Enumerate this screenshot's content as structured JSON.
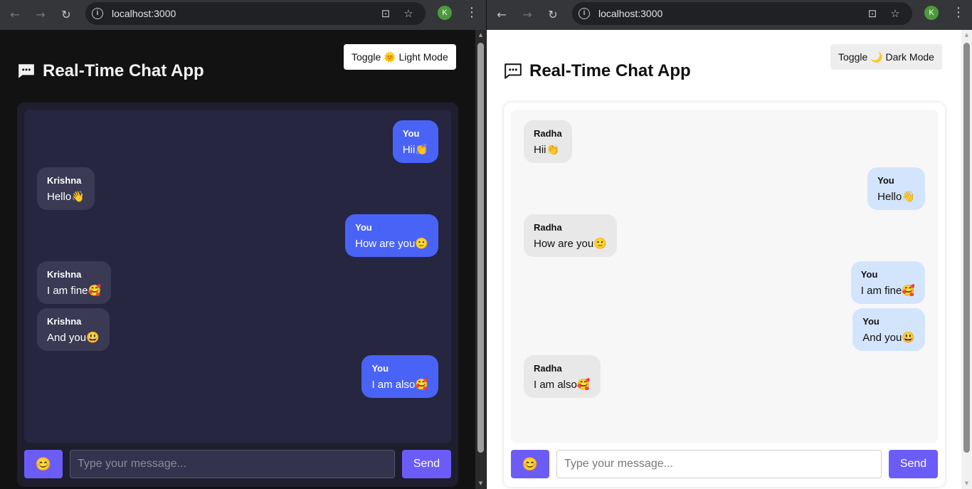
{
  "browser": {
    "url": "localhost:3000",
    "back_icon": "←",
    "forward_icon": "→",
    "reload_icon": "↻",
    "info_icon": "i",
    "install_icon": "⊡",
    "star_icon": "☆",
    "profile_initial": "K",
    "menu_icon": "⋮"
  },
  "app": {
    "title": "Real-Time Chat App",
    "placeholder": "Type your message...",
    "send_label": "Send",
    "emoji_button": "😊"
  },
  "dark_view": {
    "toggle_label": "Toggle 🌞 Light Mode",
    "messages": [
      {
        "from": "me",
        "sender": "You",
        "text": "Hii👏"
      },
      {
        "from": "them",
        "sender": "Krishna",
        "text": "Hello👋"
      },
      {
        "from": "me",
        "sender": "You",
        "text": "How are you🙂"
      },
      {
        "from": "them",
        "sender": "Krishna",
        "text": "I am fine🥰"
      },
      {
        "from": "them",
        "sender": "Krishna",
        "text": "And you😃"
      },
      {
        "from": "me",
        "sender": "You",
        "text": "I am also🥰"
      }
    ]
  },
  "light_view": {
    "toggle_label": "Toggle 🌙 Dark Mode",
    "messages": [
      {
        "from": "them",
        "sender": "Radha",
        "text": "Hii👏"
      },
      {
        "from": "me",
        "sender": "You",
        "text": "Hello👋"
      },
      {
        "from": "them",
        "sender": "Radha",
        "text": "How are you🙂"
      },
      {
        "from": "me",
        "sender": "You",
        "text": "I am fine🥰"
      },
      {
        "from": "me",
        "sender": "You",
        "text": "And you😃"
      },
      {
        "from": "them",
        "sender": "Radha",
        "text": "I am also🥰"
      }
    ]
  },
  "colors": {
    "accent": "#6c5cf7",
    "dark_bubble_me": "#4a63f7",
    "light_bubble_me": "#d3e5fc"
  }
}
